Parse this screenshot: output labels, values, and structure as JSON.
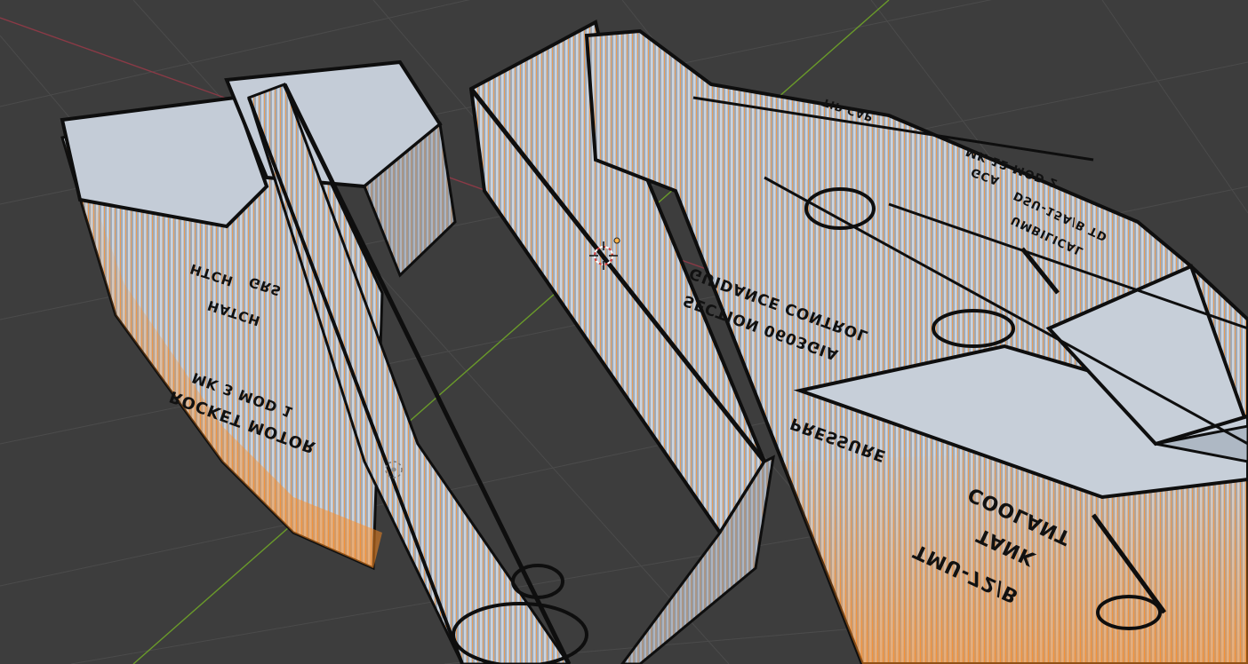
{
  "viewport": {
    "background": "#3d3d3d",
    "grid_color": "#4a4a4a",
    "x_axis_color": "#8a3a46",
    "y_axis_color": "#6a9a2a",
    "edge_color": "#ff8a1e",
    "face_color": "#b9c3d0",
    "outline_color": "#101010",
    "cursor_icon": "3d-cursor-icon",
    "origin_icon": "origin-pivot-icon"
  },
  "labels": {
    "hatch_1": "HATCH",
    "hatch_2": "GRS",
    "hatch_3": "HTCH",
    "motor_1": "MK 3 MOD 1",
    "motor_2": "ROCKET MOTOR",
    "guidance_1": "GUIDANCE CONTROL",
    "guidance_2": "SECTION 0603GIA",
    "pressure": "PRESSURE",
    "coolant_1": "COOLANT",
    "coolant_2": "TANK",
    "coolant_3": "TMU-72/B",
    "mk12_1": "MK 12 MOD 2",
    "mk12_2": "GCA",
    "umbilical_1": "DSU-15A/B TD",
    "umbilical_2": "UMBILICAL",
    "tip": "TIP CAP"
  }
}
